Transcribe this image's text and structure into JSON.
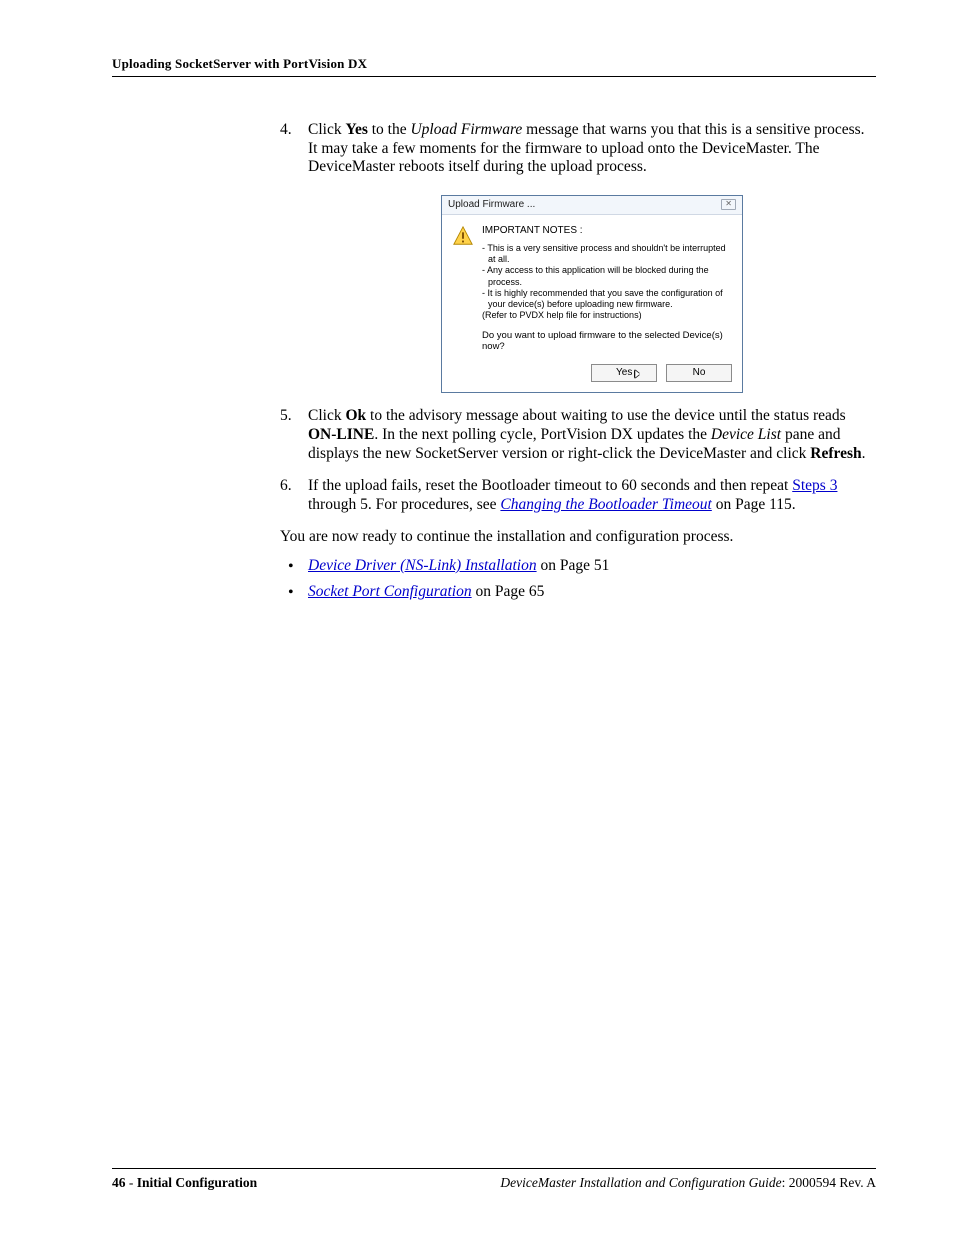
{
  "header": {
    "running_title": "Uploading SocketServer with PortVision DX"
  },
  "steps": {
    "s4": {
      "num": "4.",
      "text_pre": "Click ",
      "bold1": "Yes",
      "text_mid1": " to the ",
      "ital1": "Upload Firmware",
      "text_after": " message that warns you that this is a sensitive process. It may take a few moments for the firmware to upload onto the DeviceMaster. The DeviceMaster reboots itself during the upload process."
    },
    "s5": {
      "num": "5.",
      "pre": "Click ",
      "b1": "Ok",
      "mid1": " to the advisory message about waiting to use the device until the status reads ",
      "b2": "ON-LINE",
      "mid2": ". In the next polling cycle, PortVision DX updates the ",
      "i1": "Device List",
      "mid3": " pane and displays the new SocketServer version or right-click the DeviceMaster and click ",
      "b3": "Refresh",
      "end": "."
    },
    "s6": {
      "num": "6.",
      "pre": "If the upload fails, reset the Bootloader timeout to 60 seconds and then repeat ",
      "link1": "Steps 3",
      "mid1": " through 5. For procedures, see ",
      "link2": "Changing the Bootloader Timeout",
      "end": " on Page 115."
    }
  },
  "dialog": {
    "title": "Upload Firmware ...",
    "close": "✕",
    "heading": "IMPORTANT NOTES :",
    "notes": {
      "n1": "- This is a very sensitive process and shouldn't be interrupted at all.",
      "n2": "- Any access to this application will be blocked during the process.",
      "n3": "- It is highly recommended that you save the configuration of your device(s) before uploading new firmware.",
      "n4": "(Refer to PVDX help file for instructions)"
    },
    "question": "Do you want to upload firmware to the selected Device(s) now?",
    "yes": "Yes",
    "no": "No"
  },
  "after": {
    "para": "You are now ready to continue the installation and configuration process.",
    "b1_link": "Device Driver (NS-Link) Installation",
    "b1_tail": " on Page 51",
    "b2_link": "Socket Port Configuration",
    "b2_tail": " on Page 65"
  },
  "footer": {
    "page": "46",
    "sep": " - ",
    "section": "Initial Configuration",
    "doc": "DeviceMaster Installation and Configuration Guide",
    "rev": ": 2000594 Rev. A"
  }
}
